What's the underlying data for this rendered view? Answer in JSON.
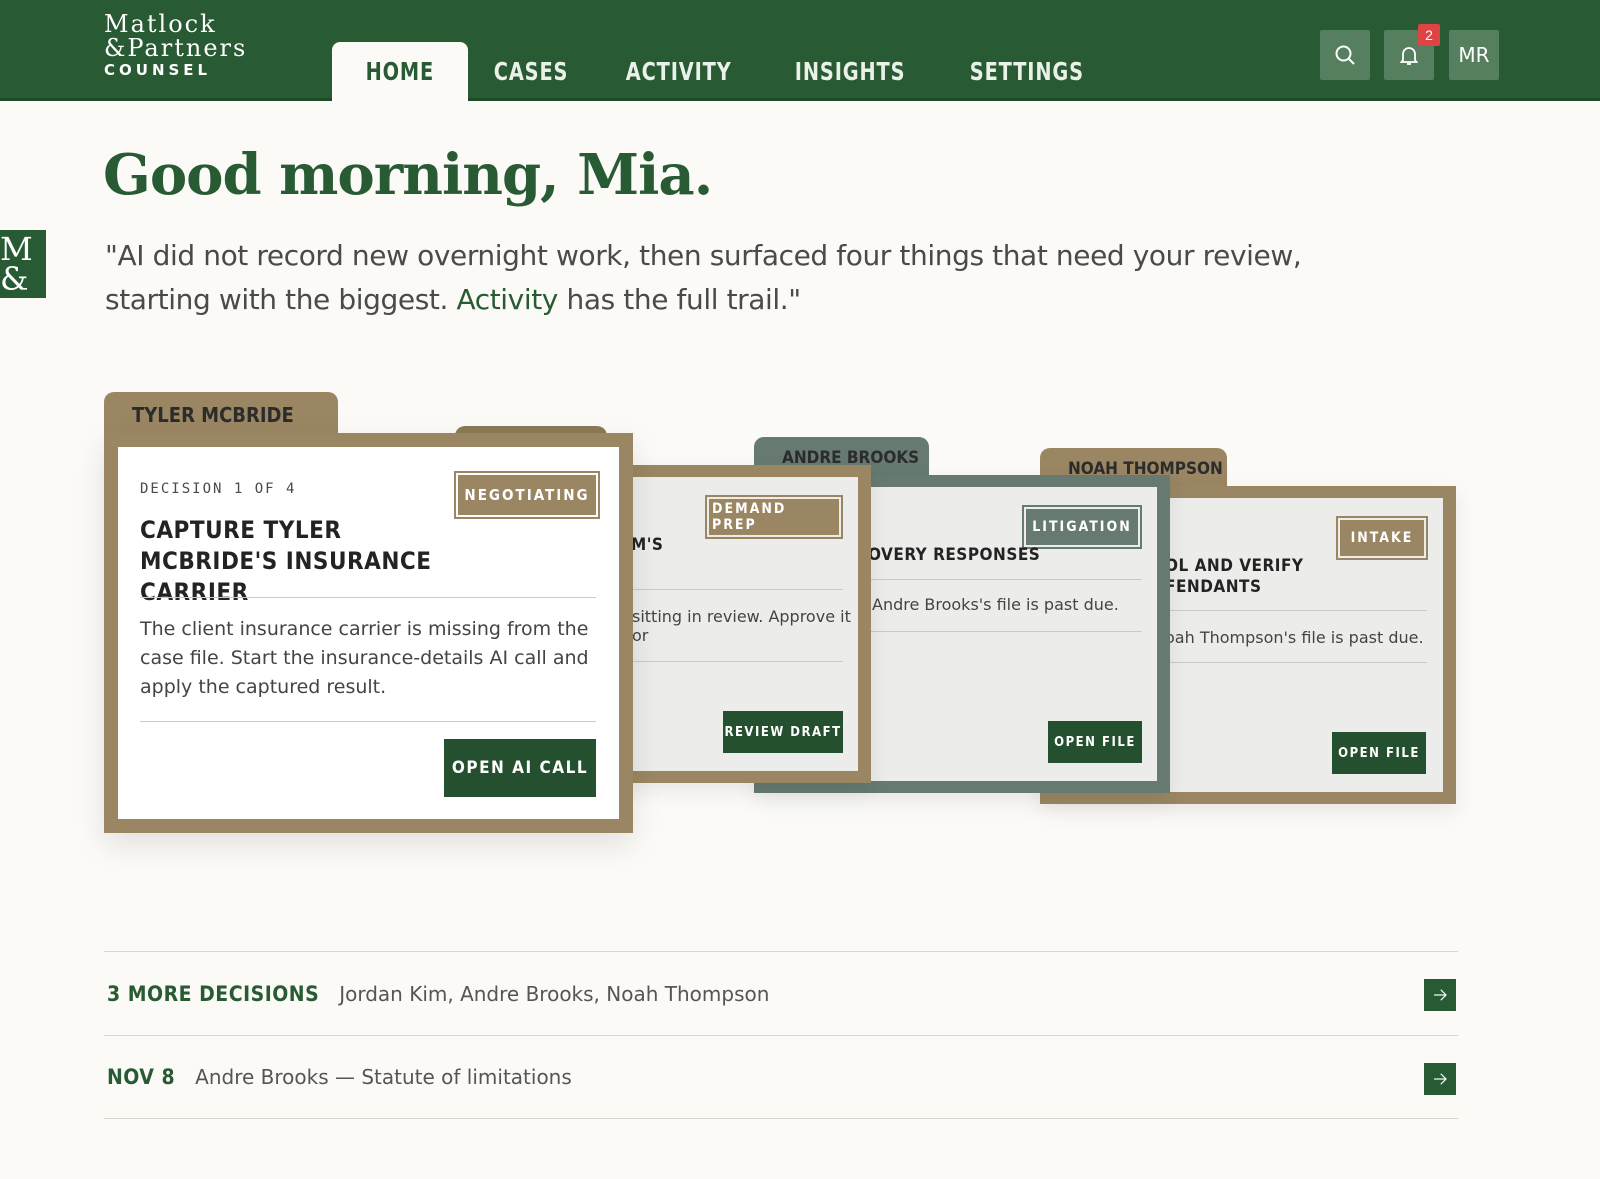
{
  "brand": {
    "line1": "Matlock",
    "line2": "&Partners",
    "line3": "COUNSEL",
    "side_mark": "M&"
  },
  "nav": {
    "tabs": [
      {
        "label": "HOME",
        "active": true
      },
      {
        "label": "CASES"
      },
      {
        "label": "ACTIVITY"
      },
      {
        "label": "INSIGHTS"
      },
      {
        "label": "SETTINGS"
      }
    ]
  },
  "header": {
    "notifications_count": "2",
    "avatar_initials": "MR",
    "icons": [
      "search-icon",
      "bell-icon"
    ]
  },
  "greeting": "Good morning, Mia.",
  "summary": {
    "before_link": "\"AI did not record new overnight work, then surfaced four things that need your review, starting with the biggest. ",
    "link": "Activity",
    "after_link": " has the full trail.\""
  },
  "decisions": [
    {
      "client": "TYLER MCBRIDE",
      "eyebrow": "DECISION 1 OF 4",
      "status": "NEGOTIATING",
      "title": "CAPTURE TYLER MCBRIDE'S INSURANCE CARRIER",
      "description": "The client insurance carrier is missing from the case file. Start the insurance-details AI call and apply the captured result.",
      "action": "OPEN AI CALL"
    },
    {
      "client": "",
      "status": "DEMAND PREP",
      "title_fragment": "M'S",
      "description_fragment": "sitting in review. Approve it or",
      "action": "REVIEW DRAFT"
    },
    {
      "client": "ANDRE BROOKS",
      "status": "LITIGATION",
      "title_fragment": "OVERY RESPONSES",
      "description_fragment": "Andre Brooks's file is past due.",
      "action": "OPEN FILE"
    },
    {
      "client": "NOAH THOMPSON",
      "status": "INTAKE",
      "title_fragment": "OL AND VERIFY\nFENDANTS",
      "description_fragment": "oah Thompson's file is past due.",
      "action": "OPEN FILE"
    }
  ],
  "list": [
    {
      "label": "3 MORE DECISIONS",
      "text": "Jordan Kim, Andre Brooks, Noah Thompson"
    },
    {
      "label": "NOV 8",
      "text": "Andre Brooks — Statute of limitations"
    }
  ],
  "colors": {
    "brand_green": "#285a34",
    "tan": "#9a8662",
    "slate": "#667a72"
  }
}
